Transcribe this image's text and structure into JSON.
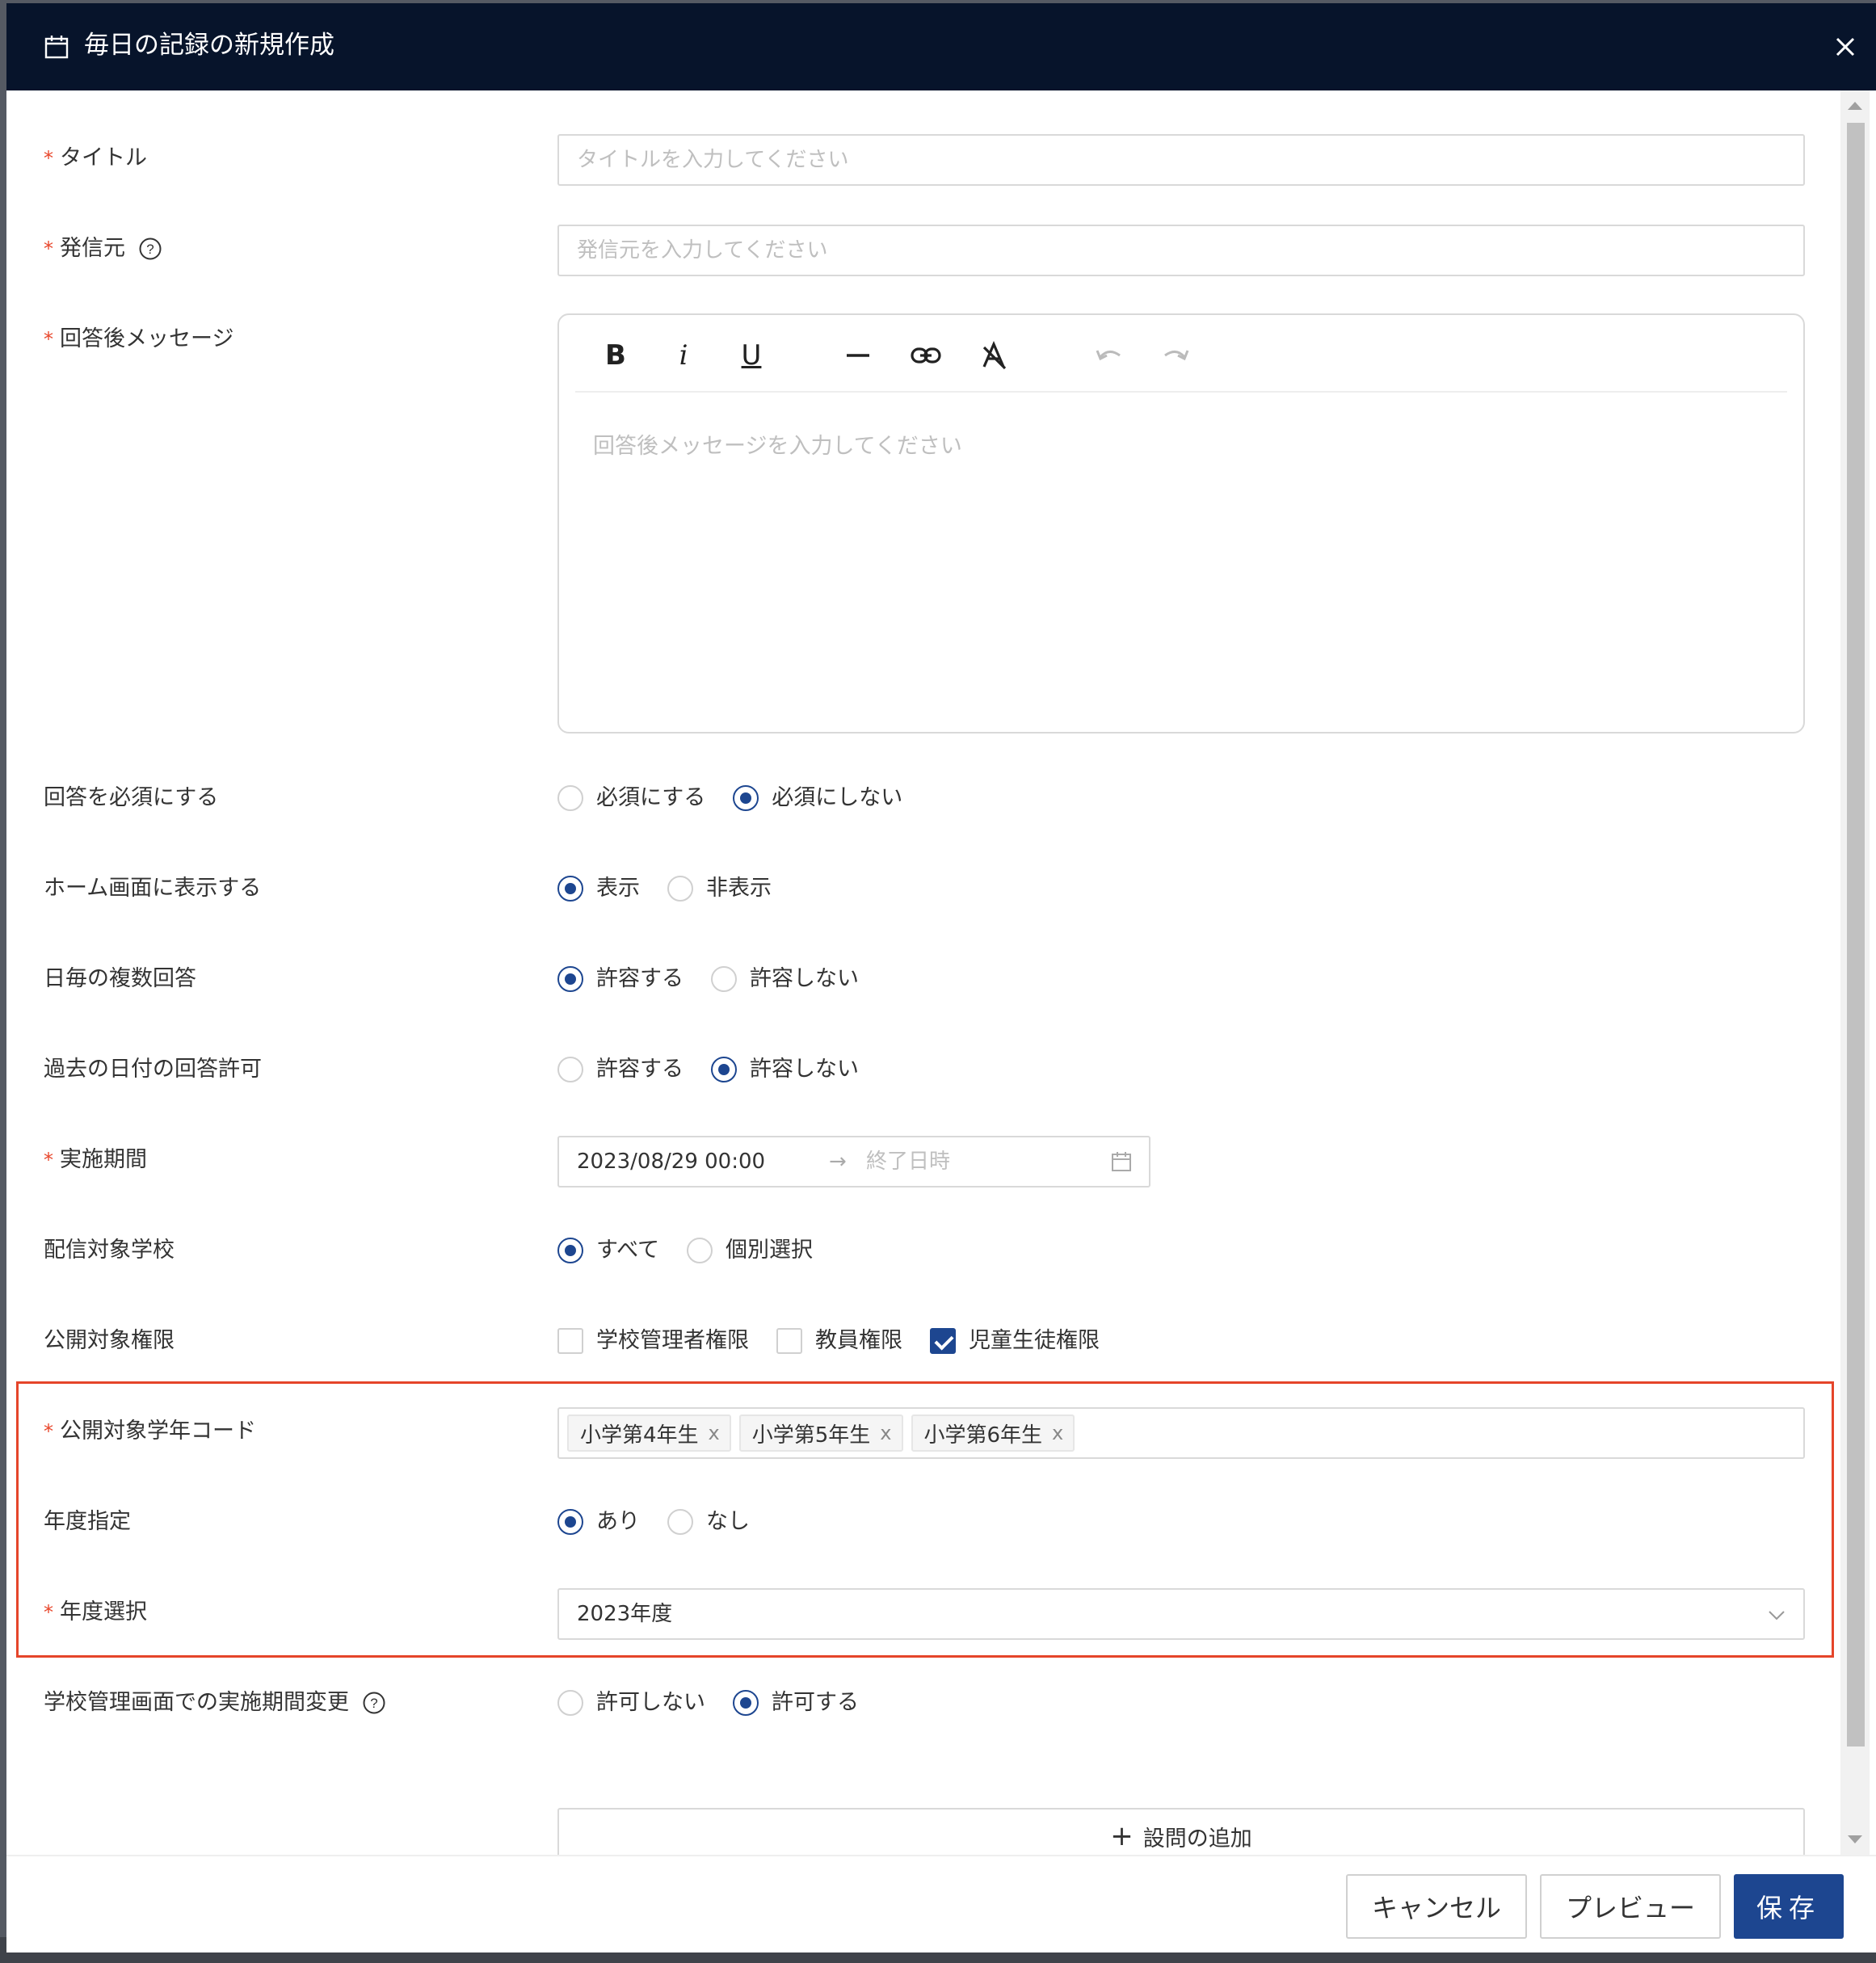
{
  "modal": {
    "title": "毎日の記録の新規作成",
    "accent": "#1d4690",
    "header_bg": "#07142b",
    "highlight_color": "#e5452a"
  },
  "fields": {
    "title": {
      "required": "*",
      "label": "タイトル",
      "placeholder": "タイトルを入力してください"
    },
    "sender": {
      "required": "*",
      "label": "発信元",
      "placeholder": "発信元を入力してください"
    },
    "message": {
      "required": "*",
      "label": "回答後メッセージ",
      "placeholder": "回答後メッセージを入力してください"
    },
    "answer_required": {
      "label": "回答を必須にする",
      "options": [
        "必須にする",
        "必須にしない"
      ],
      "selected": "必須にしない"
    },
    "home_display": {
      "label": "ホーム画面に表示する",
      "options": [
        "表示",
        "非表示"
      ],
      "selected": "表示"
    },
    "multi_answer": {
      "label": "日毎の複数回答",
      "options": [
        "許容する",
        "許容しない"
      ],
      "selected": "許容する"
    },
    "past_answer": {
      "label": "過去の日付の回答許可",
      "options": [
        "許容する",
        "許容しない"
      ],
      "selected": "許容しない"
    },
    "period": {
      "required": "*",
      "label": "実施期間",
      "start": "2023/08/29 00:00",
      "arrow": "→",
      "end_placeholder": "終了日時"
    },
    "target_school": {
      "label": "配信対象学校",
      "options": [
        "すべて",
        "個別選択"
      ],
      "selected": "すべて"
    },
    "permissions": {
      "label": "公開対象権限",
      "options": [
        "学校管理者権限",
        "教員権限",
        "児童生徒権限"
      ],
      "checked": [
        "児童生徒権限"
      ]
    },
    "grade_code": {
      "required": "*",
      "label": "公開対象学年コード",
      "tags": [
        "小学第4年生",
        "小学第5年生",
        "小学第6年生"
      ],
      "tag_remove": "x"
    },
    "year_spec": {
      "label": "年度指定",
      "options": [
        "あり",
        "なし"
      ],
      "selected": "あり"
    },
    "year_select": {
      "required": "*",
      "label": "年度選択",
      "value": "2023年度"
    },
    "period_change": {
      "label": "学校管理画面での実施期間変更",
      "options": [
        "許可しない",
        "許可する"
      ],
      "selected": "許可する"
    }
  },
  "toolbar": {
    "bold": "B",
    "italic": "i",
    "underline": "U",
    "icons": [
      "bold-icon",
      "italic-icon",
      "underline-icon",
      "horizontal-rule-icon",
      "link-icon",
      "clear-format-icon",
      "undo-icon",
      "redo-icon"
    ]
  },
  "add_question": {
    "plus": "+",
    "label": "設問の追加"
  },
  "footer": {
    "cancel": "キャンセル",
    "preview": "プレビュー",
    "save": "保存"
  }
}
